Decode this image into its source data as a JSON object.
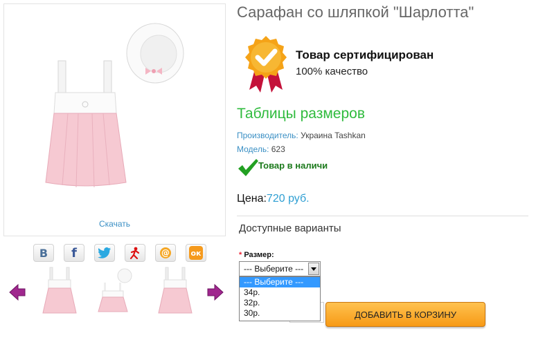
{
  "product": {
    "title": "Сарафан со шляпкой \"Шарлотта\"",
    "download_link": "Скачать",
    "certified_title": "Товар сертифицирован",
    "certified_sub": "100% качество",
    "size_tables_link": "Таблицы размеров",
    "manufacturer_label": "Производитель:",
    "manufacturer_value": "Украина Tashkan",
    "model_label": "Модель:",
    "model_value": "623",
    "stock_status": "Товар в наличи",
    "price_label": "Цена:",
    "price_value": "720 руб."
  },
  "social": {
    "vk": "В",
    "facebook": "f",
    "odnoklassniki": "ок"
  },
  "variants": {
    "heading": "Доступные варианты",
    "required_mark": "*",
    "size_label": "Размер:",
    "selected": "--- Выберите ---",
    "options": [
      "--- Выберите ---",
      "34р.",
      "32р.",
      "30р."
    ]
  },
  "cart": {
    "add_button": "ДОБАВИТЬ В КОРЗИНУ"
  },
  "colors": {
    "accent_green": "#2fbb3d",
    "link_blue": "#3a8fc4",
    "price_blue": "#2f9fd3",
    "button_orange": "#f79a16",
    "arrow_purple": "#a0278e"
  }
}
